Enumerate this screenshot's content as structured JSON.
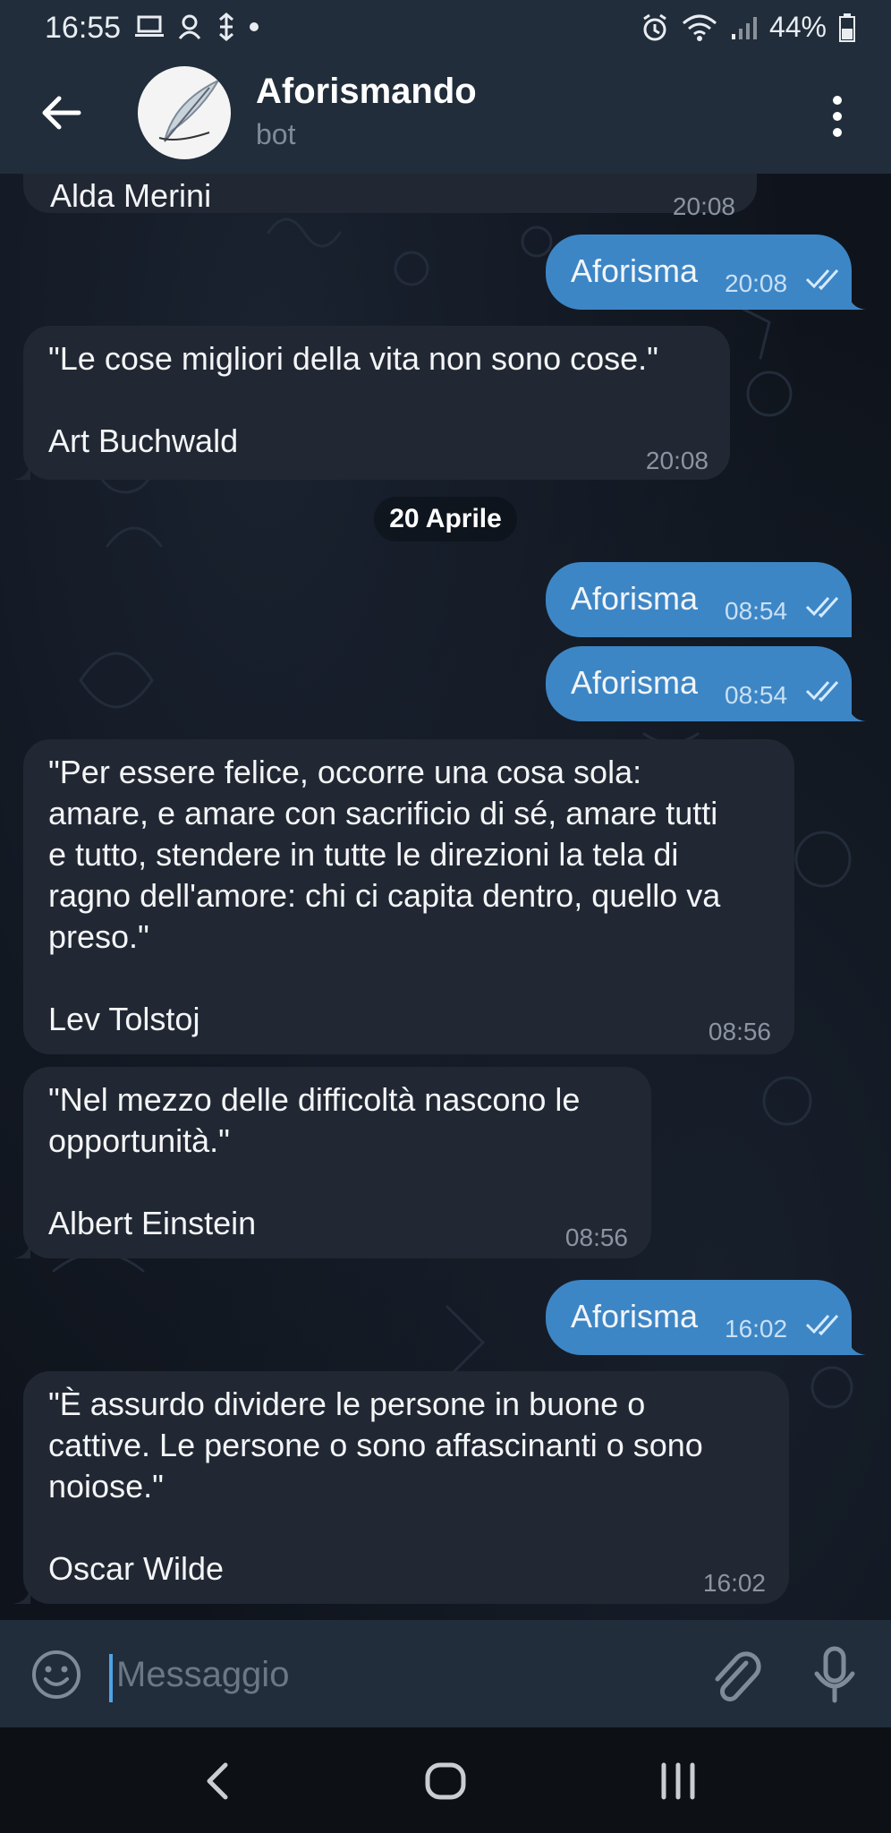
{
  "status_bar": {
    "time": "16:55",
    "battery": "44%"
  },
  "header": {
    "title": "Aforismando",
    "subtitle": "bot",
    "avatar_text": "Aforismando"
  },
  "date_separator": "20 Aprile",
  "messages": [
    {
      "direction": "in",
      "text": "Alda Merini",
      "time": "20:08"
    },
    {
      "direction": "out",
      "text": "Aforisma",
      "time": "20:08"
    },
    {
      "direction": "in",
      "text": "\"Le cose migliori della vita non sono cose.\"\n\nArt Buchwald",
      "time": "20:08"
    },
    {
      "direction": "out",
      "text": "Aforisma",
      "time": "08:54"
    },
    {
      "direction": "out",
      "text": "Aforisma",
      "time": "08:54"
    },
    {
      "direction": "in",
      "text": "\"Per essere felice, occorre una cosa sola:\namare, e amare con sacrificio di sé, amare tutti\ne tutto, stendere in tutte le direzioni la tela di\nragno dell'amore: chi ci capita dentro, quello va\npreso.\"\n\nLev Tolstoj",
      "time": "08:56"
    },
    {
      "direction": "in",
      "text": "\"Nel mezzo delle difficoltà nascono le\nopportunità.\"\n\nAlbert Einstein",
      "time": "08:56"
    },
    {
      "direction": "out",
      "text": "Aforisma",
      "time": "16:02"
    },
    {
      "direction": "in",
      "text": "\"È assurdo dividere le persone in buone o\ncattive. Le persone o sono affascinanti o sono\nnoiose.\"\n\nOscar Wilde",
      "time": "16:02"
    }
  ],
  "input": {
    "placeholder": "Messaggio",
    "value": ""
  },
  "colors": {
    "header_bg": "#212d3b",
    "incoming_bubble": "#222833",
    "outgoing_bubble": "#3d86c6",
    "accent": "#4fa3e6"
  },
  "icons": {
    "back": "arrow-left-icon",
    "menu": "more-vertical-icon",
    "emoji": "smile-icon",
    "attach": "paperclip-icon",
    "mic": "microphone-icon",
    "read": "double-check-icon"
  }
}
